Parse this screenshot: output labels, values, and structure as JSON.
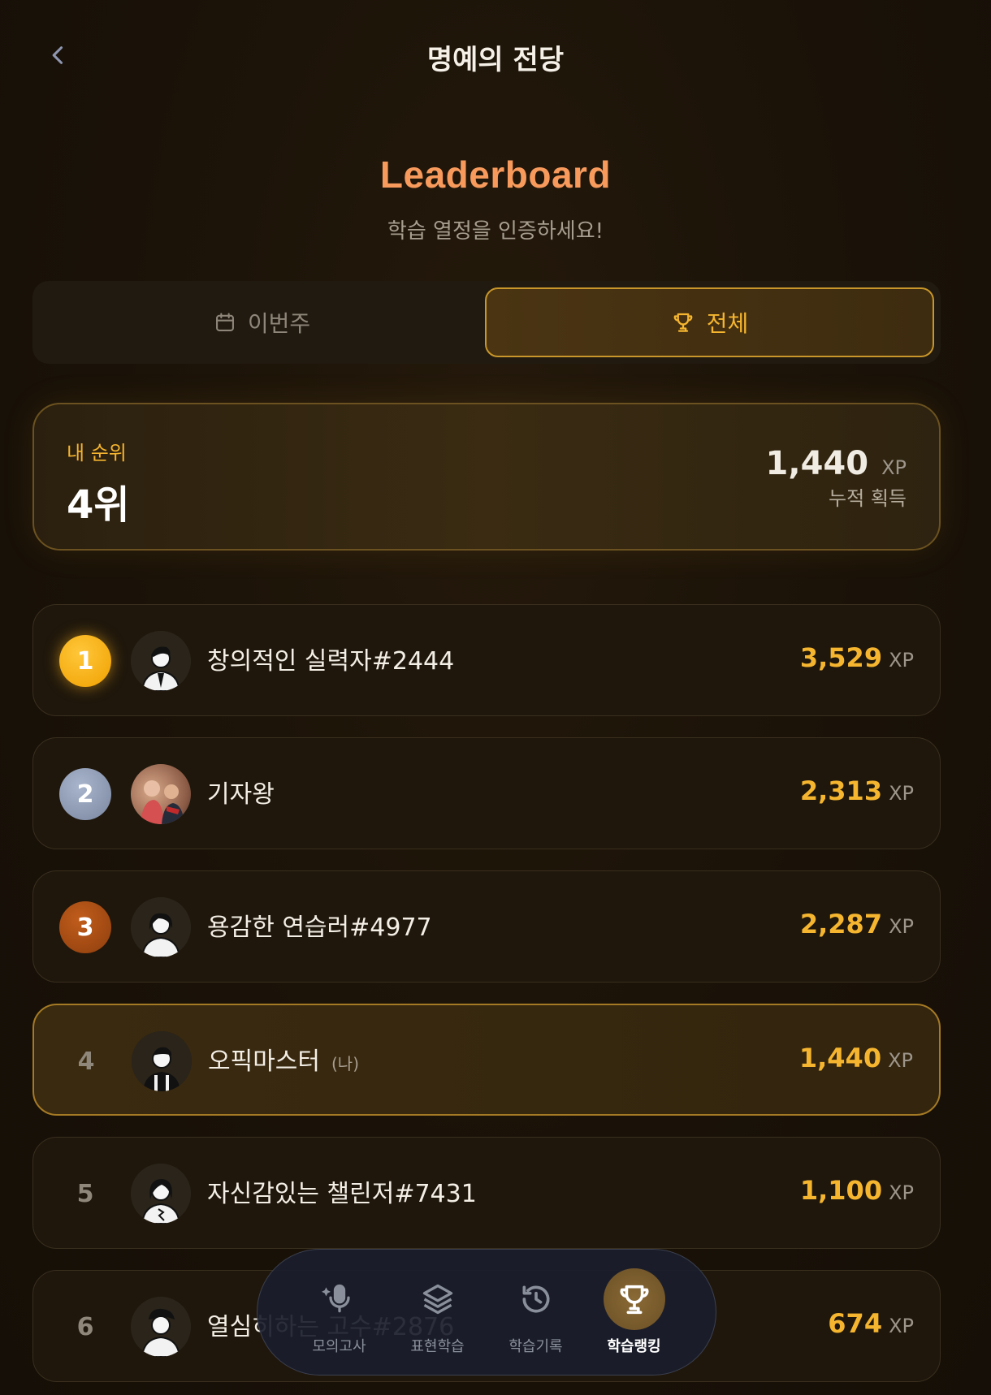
{
  "header": {
    "title": "명예의 전당"
  },
  "hero": {
    "title": "Leaderboard",
    "subtitle": "학습 열정을 인증하세요!"
  },
  "tabs": [
    {
      "label": "이번주",
      "icon": "calendar-icon",
      "active": false
    },
    {
      "label": "전체",
      "icon": "trophy-icon",
      "active": true
    }
  ],
  "my_rank": {
    "label": "내 순위",
    "value": "4위",
    "xp": "1,440",
    "xp_unit": "XP",
    "caption": "누적 획득"
  },
  "leaderboard": [
    {
      "rank": "1",
      "name": "창의적인 실력자#2444",
      "xp": "3,529",
      "unit": "XP"
    },
    {
      "rank": "2",
      "name": "기자왕",
      "xp": "2,313",
      "unit": "XP"
    },
    {
      "rank": "3",
      "name": "용감한 연습러#4977",
      "xp": "2,287",
      "unit": "XP"
    },
    {
      "rank": "4",
      "name": "오픽마스터",
      "tag": "(나)",
      "xp": "1,440",
      "unit": "XP"
    },
    {
      "rank": "5",
      "name": "자신감있는 챌린저#7431",
      "xp": "1,100",
      "unit": "XP"
    },
    {
      "rank": "6",
      "name": "열심히하는 고수#2876",
      "xp": "674",
      "unit": "XP"
    }
  ],
  "bottom_nav": [
    {
      "label": "모의고사",
      "icon": "microphone-icon",
      "active": false
    },
    {
      "label": "표현학습",
      "icon": "layers-icon",
      "active": false
    },
    {
      "label": "학습기록",
      "icon": "history-icon",
      "active": false
    },
    {
      "label": "학습랭킹",
      "icon": "trophy-icon",
      "active": true
    }
  ],
  "colors": {
    "accent": "#f5b52f",
    "hero": "#f79a5c",
    "background": "#1a1208"
  }
}
